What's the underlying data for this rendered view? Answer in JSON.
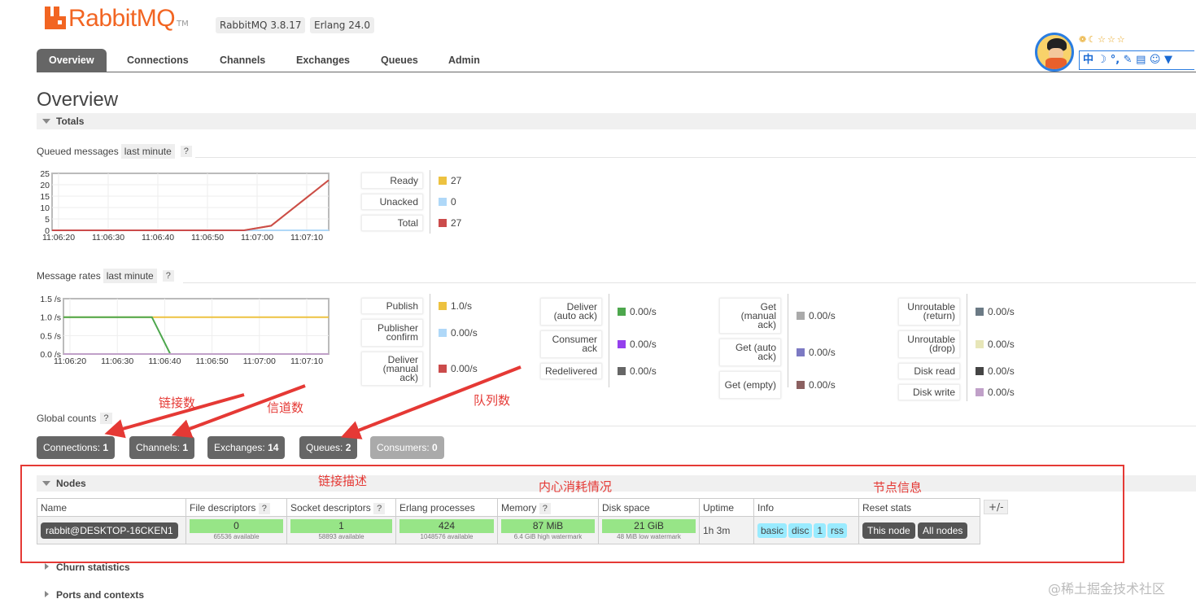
{
  "header": {
    "logo": "RabbitMQ",
    "tm": "TM",
    "version": "RabbitMQ 3.8.17",
    "erlang": "Erlang 24.0"
  },
  "tabs": [
    "Overview",
    "Connections",
    "Channels",
    "Exchanges",
    "Queues",
    "Admin"
  ],
  "page_title": "Overview",
  "totals": {
    "title": "Totals"
  },
  "queued": {
    "label": "Queued messages",
    "range": "last minute",
    "help": "?",
    "stats": [
      {
        "label": "Ready",
        "value": "27",
        "color": "#edc240"
      },
      {
        "label": "Unacked",
        "value": "0",
        "color": "#afd8f8"
      },
      {
        "label": "Total",
        "value": "27",
        "color": "#cb4b4b"
      }
    ]
  },
  "rates": {
    "label": "Message rates",
    "range": "last minute",
    "help": "?",
    "col1": [
      {
        "label": "Publish",
        "value": "1.0/s",
        "color": "#edc240"
      },
      {
        "label": "Publisher confirm",
        "value": "0.00/s",
        "color": "#afd8f8"
      },
      {
        "label": "Deliver (manual ack)",
        "value": "0.00/s",
        "color": "#cb4b4b"
      }
    ],
    "col2": [
      {
        "label": "Deliver (auto ack)",
        "value": "0.00/s",
        "color": "#4da74d"
      },
      {
        "label": "Consumer ack",
        "value": "0.00/s",
        "color": "#9440ed"
      },
      {
        "label": "Redelivered",
        "value": "0.00/s",
        "color": "#666666"
      }
    ],
    "col3": [
      {
        "label": "Get (manual ack)",
        "value": "0.00/s",
        "color": "#aaaaaa"
      },
      {
        "label": "Get (auto ack)",
        "value": "0.00/s",
        "color": "#7c79c3"
      },
      {
        "label": "Get (empty)",
        "value": "0.00/s",
        "color": "#8b6060"
      }
    ],
    "col4": [
      {
        "label": "Unroutable (return)",
        "value": "0.00/s",
        "color": "#6b7a85"
      },
      {
        "label": "Unroutable (drop)",
        "value": "0.00/s",
        "color": "#e7e6b8"
      },
      {
        "label": "Disk read",
        "value": "0.00/s",
        "color": "#444444"
      },
      {
        "label": "Disk write",
        "value": "0.00/s",
        "color": "#c0a0c8"
      }
    ]
  },
  "global": {
    "label": "Global counts",
    "help": "?",
    "counts": [
      {
        "label": "Connections:",
        "value": "1"
      },
      {
        "label": "Channels:",
        "value": "1"
      },
      {
        "label": "Exchanges:",
        "value": "14"
      },
      {
        "label": "Queues:",
        "value": "2"
      },
      {
        "label": "Consumers:",
        "value": "0"
      }
    ]
  },
  "nodes": {
    "title": "Nodes",
    "plusminus": "+/-",
    "headers": [
      "Name",
      "File descriptors",
      "Socket descriptors",
      "Erlang processes",
      "Memory",
      "Disk space",
      "Uptime",
      "Info",
      "Reset stats"
    ],
    "row": {
      "name": "rabbit@DESKTOP-16CKEN1",
      "fd": "0",
      "fd_sub": "65536 available",
      "sd": "1",
      "sd_sub": "58893 available",
      "ep": "424",
      "ep_sub": "1048576 available",
      "mem": "87 MiB",
      "mem_sub": "6.4 GiB high watermark",
      "disk": "21 GiB",
      "disk_sub": "48 MiB low watermark",
      "uptime": "1h 3m",
      "info": [
        "basic",
        "disc",
        "1",
        "rss"
      ],
      "reset": [
        "This node",
        "All nodes"
      ]
    }
  },
  "collapsed": [
    "Churn statistics",
    "Ports and contexts"
  ],
  "annotations": {
    "conn": "链接数",
    "chan": "信道数",
    "queue": "队列数",
    "desc": "链接描述",
    "mem": "内心消耗情况",
    "node": "节点信息"
  },
  "watermark": "@稀土掘金技术社区",
  "toolbar": {
    "row1": "❁☾☆☆☆",
    "row2": "中 ☽ °, ✎ ▤ ☺ ▼"
  },
  "chart_data": [
    {
      "type": "line",
      "title": "Queued messages",
      "x": [
        "11:06:20",
        "11:06:30",
        "11:06:40",
        "11:06:50",
        "11:07:00",
        "11:07:10"
      ],
      "yticks": [
        "25",
        "20",
        "15",
        "10",
        "5",
        "0"
      ],
      "ylim": [
        0,
        25
      ],
      "series": [
        {
          "name": "Ready",
          "color": "#edc240",
          "points": [
            [
              0,
              0
            ],
            [
              50,
              0
            ],
            [
              57,
              2
            ],
            [
              72,
              22
            ]
          ]
        },
        {
          "name": "Unacked",
          "color": "#afd8f8",
          "points": [
            [
              0,
              0
            ],
            [
              72,
              0
            ]
          ]
        },
        {
          "name": "Total",
          "color": "#cb4b4b",
          "points": [
            [
              0,
              0
            ],
            [
              50,
              0
            ],
            [
              57,
              2
            ],
            [
              72,
              22
            ]
          ]
        }
      ]
    },
    {
      "type": "line",
      "title": "Message rates",
      "x": [
        "11:06:20",
        "11:06:30",
        "11:06:40",
        "11:06:50",
        "11:07:00",
        "11:07:10"
      ],
      "yticks": [
        "1.5 /s",
        "1.0 /s",
        "0.5 /s",
        "0.0 /s"
      ],
      "ylim": [
        0,
        1.5
      ],
      "series": [
        {
          "name": "Publish",
          "color": "#edc240",
          "points": [
            [
              0,
              1
            ],
            [
              72,
              1
            ]
          ]
        },
        {
          "name": "Deliver (auto ack)",
          "color": "#4da74d",
          "points": [
            [
              0,
              1
            ],
            [
              24,
              1
            ],
            [
              29,
              0
            ],
            [
              72,
              0
            ]
          ]
        },
        {
          "name": "Unroutable (drop)",
          "color": "#c0a0c8",
          "points": [
            [
              0,
              0
            ],
            [
              72,
              0
            ]
          ]
        }
      ]
    }
  ]
}
